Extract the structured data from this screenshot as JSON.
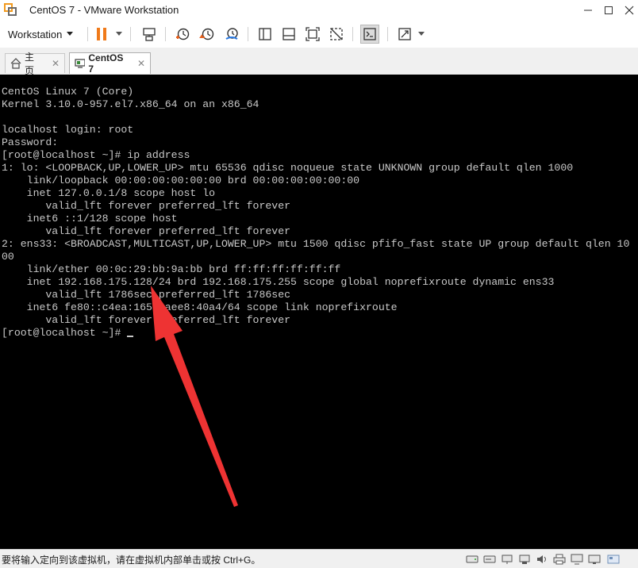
{
  "window": {
    "title": "CentOS 7 - VMware Workstation",
    "app_icon": "vmware-icon",
    "controls": [
      "minimize-icon",
      "maximize-icon",
      "close-icon"
    ]
  },
  "toolbar": {
    "menu_label": "Workstation",
    "icons": [
      "pause-icon",
      "send-keys-icon",
      "snapshot-icon",
      "revert-snapshot-icon",
      "snapshot-manager-icon",
      "library-view-icon",
      "thumbnail-view-icon",
      "fullscreen-icon",
      "unity-icon",
      "console-view-icon",
      "stretch-icon"
    ]
  },
  "tabs": [
    {
      "label": "主页",
      "icon": "home-icon",
      "close": "✕"
    },
    {
      "label": "CentOS 7",
      "icon": "vm-icon",
      "close": "✕"
    }
  ],
  "console": {
    "lines": [
      "CentOS Linux 7 (Core)",
      "Kernel 3.10.0-957.el7.x86_64 on an x86_64",
      "",
      "localhost login: root",
      "Password:",
      "[root@localhost ~]# ip address",
      "1: lo: <LOOPBACK,UP,LOWER_UP> mtu 65536 qdisc noqueue state UNKNOWN group default qlen 1000",
      "    link/loopback 00:00:00:00:00:00 brd 00:00:00:00:00:00",
      "    inet 127.0.0.1/8 scope host lo",
      "       valid_lft forever preferred_lft forever",
      "    inet6 ::1/128 scope host",
      "       valid_lft forever preferred_lft forever",
      "2: ens33: <BROADCAST,MULTICAST,UP,LOWER_UP> mtu 1500 qdisc pfifo_fast state UP group default qlen 10",
      "00",
      "    link/ether 00:0c:29:bb:9a:bb brd ff:ff:ff:ff:ff:ff",
      "    inet 192.168.175.128/24 brd 192.168.175.255 scope global noprefixroute dynamic ens33",
      "       valid_lft 1786sec preferred_lft 1786sec",
      "    inet6 fe80::c4ea:1658:aee8:40a4/64 scope link noprefixroute",
      "       valid_lft forever preferred_lft forever"
    ],
    "prompt": "[root@localhost ~]# "
  },
  "annotation": {
    "color": "#ee3333",
    "shape": "red-arrow"
  },
  "status": {
    "text": "要将输入定向到该虚拟机，请在虚拟机内部单击或按 Ctrl+G。",
    "icons": [
      "hard-disk-icon",
      "cd-drive-icon",
      "network-icon",
      "usb-icon",
      "sound-icon",
      "printer-icon",
      "display-icon",
      "resize-grip-icon"
    ]
  }
}
